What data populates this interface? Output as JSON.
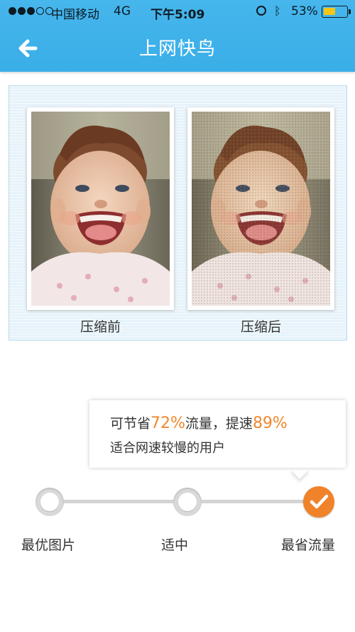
{
  "status_bar": {
    "carrier": "中国移动",
    "network": "4G",
    "time": "下午5:09",
    "battery": "53%",
    "battery_level": 0.53
  },
  "header": {
    "title": "上网快鸟",
    "back_icon": "arrow-left-icon"
  },
  "comparison": {
    "before_label": "压缩前",
    "after_label": "压缩后"
  },
  "tooltip": {
    "prefix": "可节省",
    "traffic_saving": "72%",
    "middle": "流量，提速",
    "speedup": "89%",
    "description": "适合网速较慢的用户"
  },
  "quality_slider": {
    "options": [
      "最优图片",
      "适中",
      "最省流量"
    ],
    "selected": "最省流量"
  },
  "colors": {
    "header": "#3aaee8",
    "accent": "#f0832a"
  }
}
